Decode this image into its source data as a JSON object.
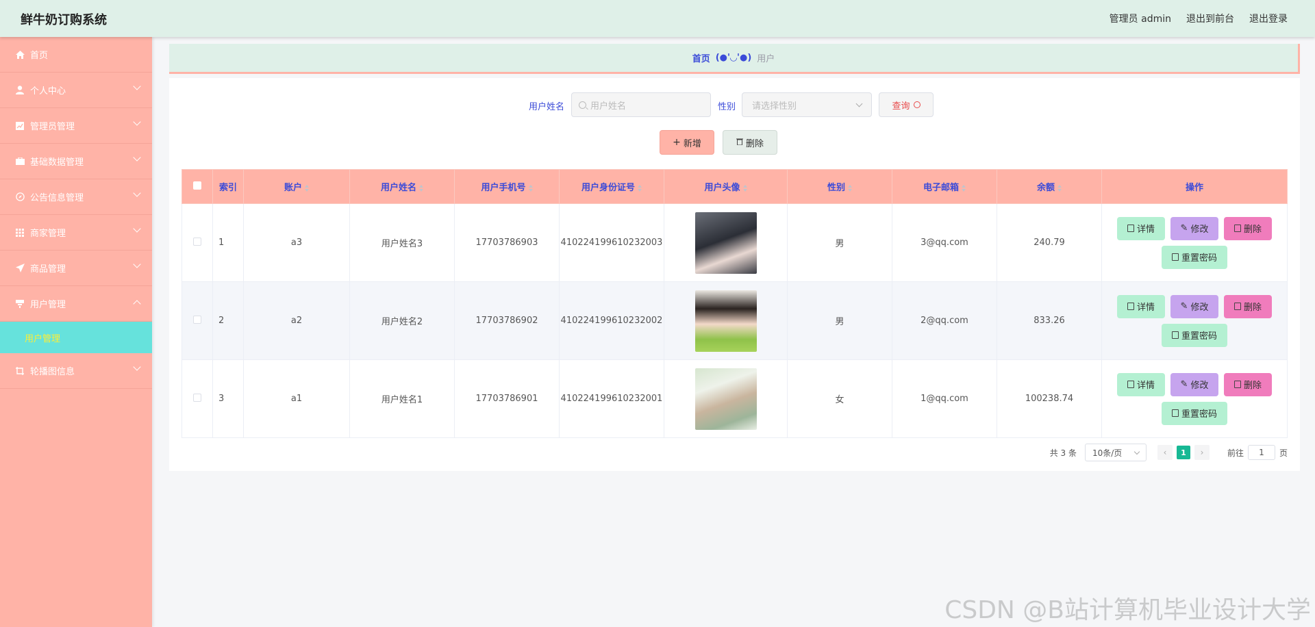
{
  "header": {
    "title": "鲜牛奶订购系统",
    "links": [
      "管理员 admin",
      "退出到前台",
      "退出登录"
    ]
  },
  "sidebar": {
    "items": [
      {
        "label": "首页",
        "icon": "home-icon"
      },
      {
        "label": "个人中心",
        "icon": "user-icon"
      },
      {
        "label": "管理员管理",
        "icon": "chart-icon"
      },
      {
        "label": "基础数据管理",
        "icon": "briefcase-icon"
      },
      {
        "label": "公告信息管理",
        "icon": "compass-icon"
      },
      {
        "label": "商家管理",
        "icon": "grid-icon"
      },
      {
        "label": "商品管理",
        "icon": "send-icon"
      },
      {
        "label": "用户管理",
        "icon": "filter-icon"
      },
      {
        "label": "轮播图信息",
        "icon": "crop-icon"
      }
    ],
    "sub_item": "用户管理"
  },
  "breadcrumb": {
    "home": "首页",
    "face": "(●'◡'●)",
    "current": "用户"
  },
  "search": {
    "name_label": "用户姓名",
    "name_placeholder": "用户姓名",
    "gender_label": "性别",
    "gender_placeholder": "请选择性别",
    "query_label": "查询"
  },
  "actions": {
    "add_label": "新增",
    "delete_label": "删除"
  },
  "table": {
    "columns": [
      "索引",
      "账户",
      "用户姓名",
      "用户手机号",
      "用户身份证号",
      "用户头像",
      "性别",
      "电子邮箱",
      "余额",
      "操作"
    ],
    "rows": [
      {
        "index": "1",
        "account": "a3",
        "name": "用户姓名3",
        "phone": "17703786903",
        "id_card": "410224199610232003",
        "gender": "男",
        "email": "3@qq.com",
        "balance": "240.79"
      },
      {
        "index": "2",
        "account": "a2",
        "name": "用户姓名2",
        "phone": "17703786902",
        "id_card": "410224199610232002",
        "gender": "男",
        "email": "2@qq.com",
        "balance": "833.26"
      },
      {
        "index": "3",
        "account": "a1",
        "name": "用户姓名1",
        "phone": "17703786901",
        "id_card": "410224199610232001",
        "gender": "女",
        "email": "1@qq.com",
        "balance": "100238.74"
      }
    ],
    "ops": {
      "detail": "详情",
      "edit": "修改",
      "delete": "删除",
      "reset": "重置密码"
    }
  },
  "pagination": {
    "total": "共 3 条",
    "page_size": "10条/页",
    "current_page": "1",
    "goto_label": "前往",
    "goto_value": "1",
    "page_unit": "页"
  },
  "watermark": "CSDN @B站计算机毕业设计大学",
  "colors": {
    "accent": "#ffb3a7",
    "header": "#dff0e8",
    "active_sub": "#66e2dc",
    "link": "#3b4bd8"
  }
}
